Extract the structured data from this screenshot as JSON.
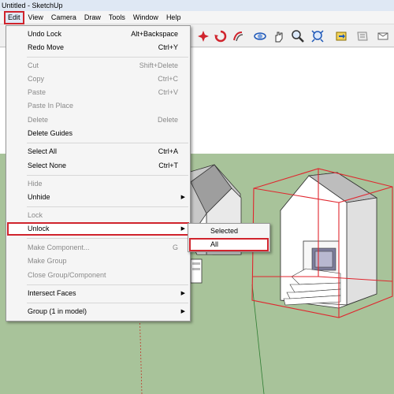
{
  "window": {
    "title": "Untitled - SketchUp"
  },
  "menubar": {
    "items": [
      {
        "label": "Edit",
        "active": true
      },
      {
        "label": "View"
      },
      {
        "label": "Camera"
      },
      {
        "label": "Draw"
      },
      {
        "label": "Tools"
      },
      {
        "label": "Window"
      },
      {
        "label": "Help"
      }
    ]
  },
  "toolbar": {
    "icons": [
      "rotate-icon",
      "follow-me-icon",
      "offset-icon",
      "orbit-icon",
      "pan-icon",
      "zoom-icon",
      "zoom-extents-icon",
      "previous-view-icon",
      "next-view-icon"
    ]
  },
  "edit_menu": {
    "items": [
      {
        "label": "Undo Lock",
        "shortcut": "Alt+Backspace",
        "enabled": true
      },
      {
        "label": "Redo Move",
        "shortcut": "Ctrl+Y",
        "enabled": true
      },
      {
        "label": "Cut",
        "shortcut": "Shift+Delete",
        "enabled": false
      },
      {
        "label": "Copy",
        "shortcut": "Ctrl+C",
        "enabled": false
      },
      {
        "label": "Paste",
        "shortcut": "Ctrl+V",
        "enabled": false
      },
      {
        "label": "Paste In Place",
        "shortcut": "",
        "enabled": false
      },
      {
        "label": "Delete",
        "shortcut": "Delete",
        "enabled": false
      },
      {
        "label": "Delete Guides",
        "shortcut": "",
        "enabled": true
      },
      {
        "label": "Select All",
        "shortcut": "Ctrl+A",
        "enabled": true
      },
      {
        "label": "Select None",
        "shortcut": "Ctrl+T",
        "enabled": true
      },
      {
        "label": "Hide",
        "shortcut": "",
        "enabled": false
      },
      {
        "label": "Unhide",
        "shortcut": "",
        "enabled": true,
        "submenu": true
      },
      {
        "label": "Lock",
        "shortcut": "",
        "enabled": false
      },
      {
        "label": "Unlock",
        "shortcut": "",
        "enabled": true,
        "submenu": true,
        "highlighted": true
      },
      {
        "label": "Make Component...",
        "shortcut": "G",
        "enabled": false
      },
      {
        "label": "Make Group",
        "shortcut": "",
        "enabled": false
      },
      {
        "label": "Close Group/Component",
        "shortcut": "",
        "enabled": false
      },
      {
        "label": "Intersect Faces",
        "shortcut": "",
        "enabled": true,
        "submenu": true
      },
      {
        "label": "Group (1 in model)",
        "shortcut": "",
        "enabled": true,
        "submenu": true
      }
    ]
  },
  "unlock_submenu": {
    "items": [
      {
        "label": "Selected"
      },
      {
        "label": "All",
        "highlighted": true
      }
    ]
  },
  "colors": {
    "highlight_border": "#d0242d",
    "ground": "#a8c39a",
    "sky": "#ffffff"
  }
}
